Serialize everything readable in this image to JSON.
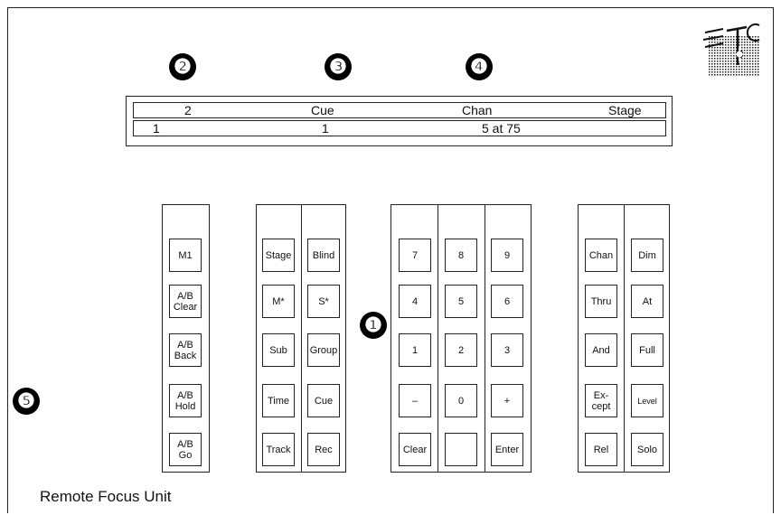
{
  "callouts": {
    "c1": "❶",
    "c2": "❷",
    "c3": "❸",
    "c4": "❹",
    "c5": "❺"
  },
  "display": {
    "row1": [
      "2",
      "Cue",
      "Chan",
      "Stage"
    ],
    "row2": [
      "1",
      "1",
      "5 at 75"
    ]
  },
  "keys": {
    "mac": [
      "M1",
      "A/B\nClear",
      "A/B\nBack",
      "A/B\nHold",
      "A/B\nGo"
    ],
    "mode_left": [
      "Stage",
      "M*",
      "Sub",
      "Time",
      "Track"
    ],
    "mode_right": [
      "Blind",
      "S*",
      "Group",
      "Cue",
      "Rec"
    ],
    "num_col1": [
      "7",
      "4",
      "1",
      "–",
      "Clear"
    ],
    "num_col2": [
      "8",
      "5",
      "2",
      "0",
      ""
    ],
    "num_col3": [
      "9",
      "6",
      "3",
      "+",
      "Enter"
    ],
    "cmd_left": [
      "Chan",
      "Thru",
      "And",
      "Ex-\ncept",
      "Rel"
    ],
    "cmd_right": [
      "Dim",
      "At",
      "Full",
      "Level",
      "Solo"
    ]
  },
  "caption": "Remote Focus Unit",
  "logo_icon": "etc-logo-icon",
  "colors": {
    "ink": "#111111",
    "background": "#ffffff"
  }
}
